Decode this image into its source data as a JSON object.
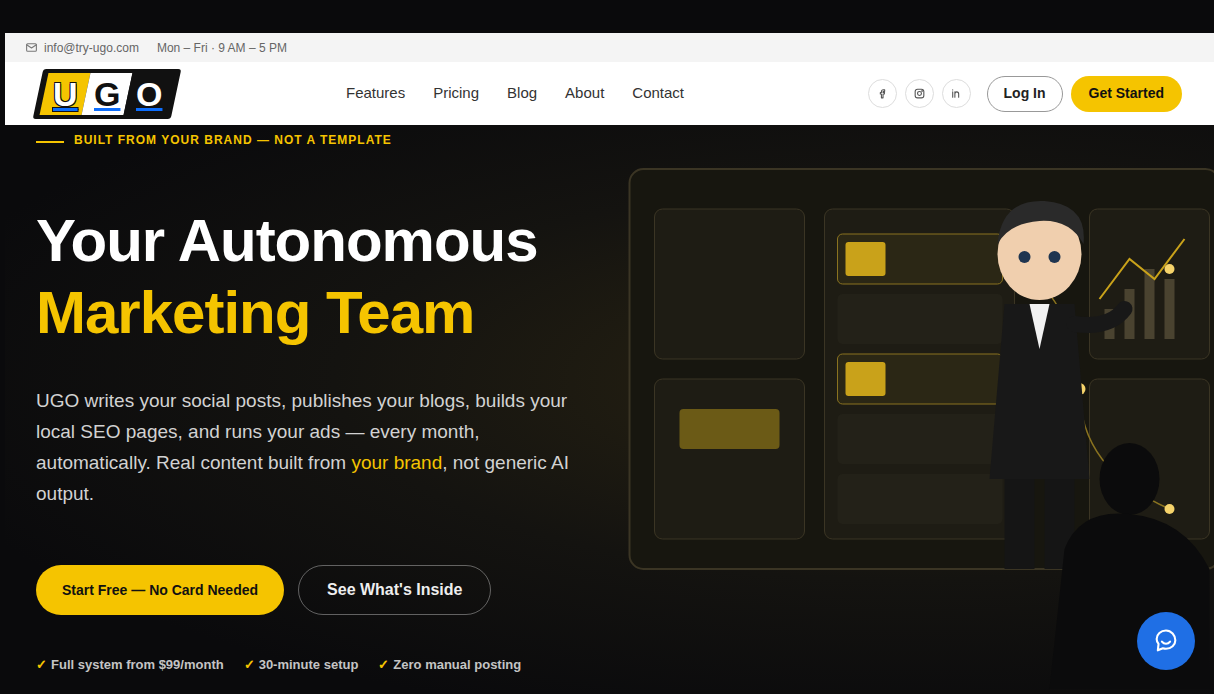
{
  "topbar": {
    "email": "info@try-ugo.com",
    "hours": "Mon – Fri · 9 AM – 5 PM"
  },
  "logo": {
    "letters": [
      "U",
      "G",
      "O"
    ]
  },
  "nav": {
    "links": [
      "Features",
      "Pricing",
      "Blog",
      "About",
      "Contact"
    ],
    "login": "Log In",
    "cta": "Get Started"
  },
  "hero": {
    "eyebrow": "BUILT FROM YOUR BRAND — NOT A TEMPLATE",
    "title": [
      "Your Autonomous",
      "Marketing Team"
    ],
    "description": [
      {
        "text": "UGO writes your social posts, publishes your blogs, builds your local SEO pages, and runs your ads — every month, automatically. Real content built from ",
        "highlight": false
      },
      {
        "text": "your brand",
        "highlight": true
      },
      {
        "text": ", not generic AI output.",
        "highlight": false
      }
    ],
    "primary_button": "Start Free — No Card Needed",
    "secondary_button": "See What's Inside",
    "checks": [
      {
        "icon": "✓",
        "text": "Full system from $99/month"
      },
      {
        "icon": "✓",
        "text": "30-minute setup"
      },
      {
        "icon": "✓",
        "text": "Zero manual posting"
      }
    ]
  }
}
